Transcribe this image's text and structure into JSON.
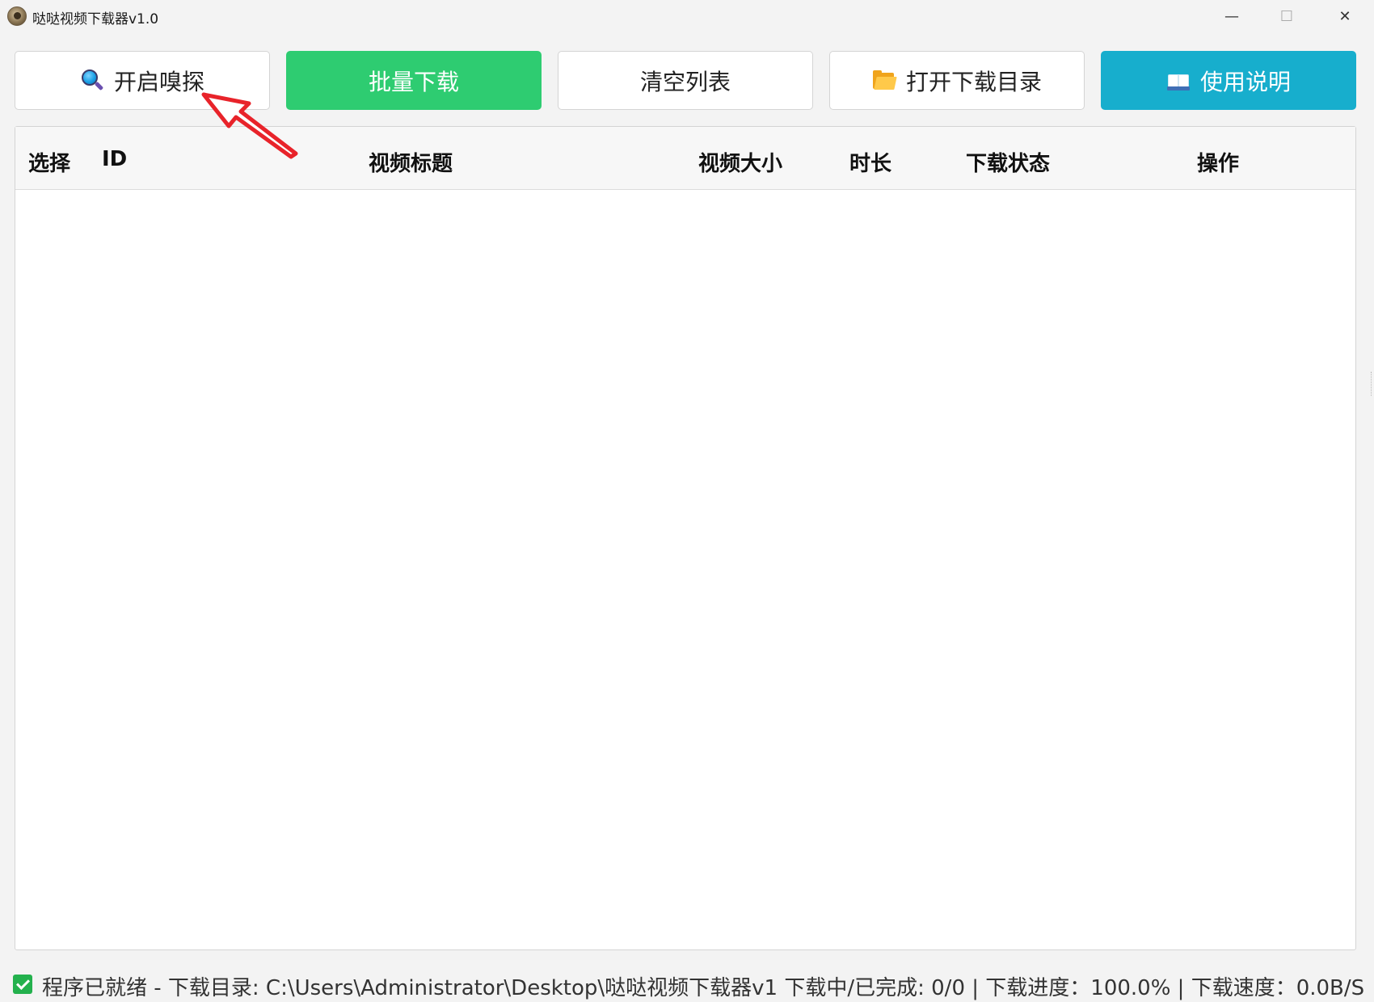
{
  "window": {
    "title": "哒哒视频下载器v1.0",
    "controls": {
      "minimize": "—",
      "maximize": "☐",
      "close": "✕"
    }
  },
  "toolbar": {
    "sniff_label": "开启嗅探",
    "batch_download_label": "批量下载",
    "clear_list_label": "清空列表",
    "open_dir_label": "打开下载目录",
    "instructions_label": "使用说明",
    "icons": {
      "sniff": "magnifier-icon",
      "open_dir": "folder-icon",
      "instructions": "book-icon"
    },
    "colors": {
      "batch_download": "#2ecc71",
      "instructions": "#17aecd"
    }
  },
  "table": {
    "columns": [
      "选择",
      "ID",
      "视频标题",
      "视频大小",
      "时长",
      "下载状态",
      "操作"
    ],
    "rows": []
  },
  "status": {
    "text": "程序已就绪 - 下载目录: C:\\Users\\Administrator\\Desktop\\哒哒视频下载器v1 下载中/已完成: 0/0 | 下载进度：100.0% | 下载速度：0.0B/S",
    "icon": "check-icon"
  },
  "annotation": {
    "type": "red-arrow",
    "points_to": "sniff-button"
  }
}
